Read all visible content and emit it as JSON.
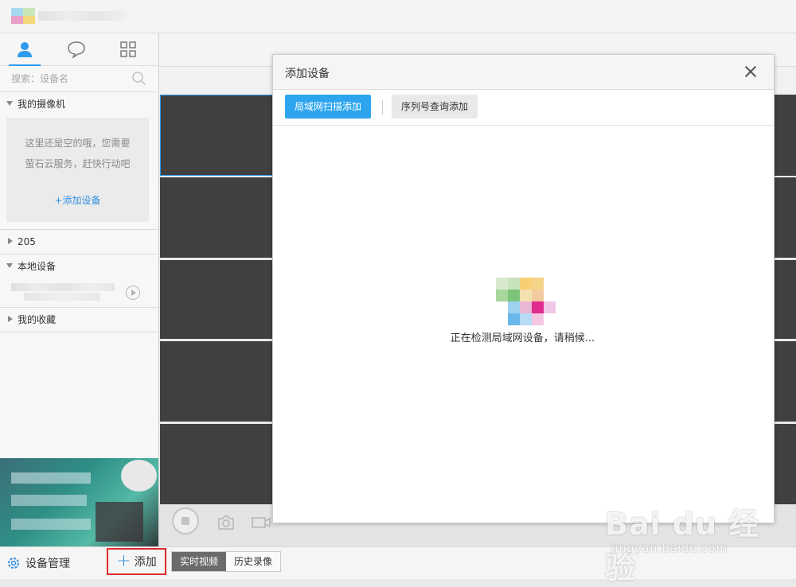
{
  "sidebar": {
    "tabs": [
      {
        "icon": "user-icon",
        "active": true
      },
      {
        "icon": "chat-bubble-icon",
        "active": false
      },
      {
        "icon": "grid-apps-icon",
        "active": false
      }
    ],
    "search": {
      "placeholder": "搜索：设备名",
      "value": ""
    },
    "groups": {
      "my_cameras": "我的摄像机",
      "group_205": "205",
      "local_devices": "本地设备",
      "favorites": "我的收藏"
    },
    "empty": {
      "line1": "这里还是空的哦，您需要",
      "line2": "萤石云服务，赶快行动吧",
      "add_link": "+添加设备"
    }
  },
  "bottom": {
    "device_management": "设备管理",
    "add": "添加",
    "mode_tabs": [
      {
        "label": "实时视频",
        "active": true
      },
      {
        "label": "历史录像",
        "active": false
      }
    ]
  },
  "dialog": {
    "title": "添加设备",
    "tabs": [
      {
        "label": "局域网扫描添加",
        "active": true
      },
      {
        "label": "序列号查询添加",
        "active": false
      }
    ],
    "status": "正在检测局域网设备，请稍候..."
  },
  "watermark": {
    "main": "Bai du 经验",
    "sub": "jingyan.baidu.com"
  },
  "colors": {
    "accent": "#2da5ee",
    "highlight_border": "#e02a2a",
    "tile": "#404040",
    "active_mode_tab": "#6b6b6b"
  }
}
